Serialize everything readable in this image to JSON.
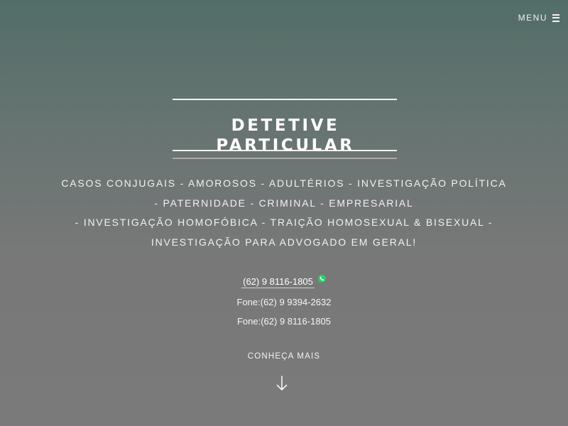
{
  "header": {
    "menu_label": "MENU"
  },
  "hero": {
    "title": "DETETIVE PARTICULAR",
    "services": [
      "CASOS CONJUGAIS - AMOROSOS - ADULTÉRIOS - INVESTIGAÇÃO POLÍTICA",
      "- PATERNIDADE - CRIMINAL - EMPRESARIAL",
      "- INVESTIGAÇÃO HOMOFÓBICA - TRAIÇÃO HOMOSEXUAL & BISEXUAL -",
      "INVESTIGAÇÃO PARA ADVOGADO EM GERAL!"
    ]
  },
  "contacts": {
    "whatsapp_number": "(62) 9 8116-1805",
    "whatsapp_icon": "whatsapp-icon",
    "phone_1": "Fone:(62) 9 9394-2632",
    "phone_2": "Fone:(62) 9 8116-1805"
  },
  "cta": {
    "label": "CONHEÇA MAIS",
    "icon": "arrow-down-icon"
  },
  "colors": {
    "gradient_top": "#526d68",
    "gradient_bottom": "#7a7a7a",
    "text": "#ffffff",
    "whatsapp_green": "#25d366"
  }
}
